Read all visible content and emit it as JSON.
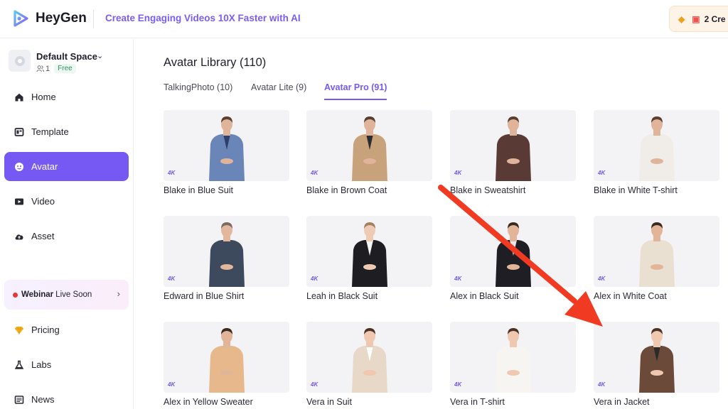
{
  "header": {
    "brand": "HeyGen",
    "tagline": "Create Engaging Videos 10X Faster with AI",
    "credits": "2 Cre"
  },
  "sidebar": {
    "space_name": "Default Space",
    "member_count": "1",
    "plan": "Free",
    "items": [
      {
        "label": "Home",
        "icon": "home-icon"
      },
      {
        "label": "Template",
        "icon": "template-icon"
      },
      {
        "label": "Avatar",
        "icon": "avatar-icon",
        "active": true
      },
      {
        "label": "Video",
        "icon": "video-icon"
      },
      {
        "label": "Asset",
        "icon": "asset-icon"
      }
    ],
    "webinar": {
      "bold": "Webinar",
      "rest": "Live Soon"
    },
    "bottom_items": [
      {
        "label": "Pricing",
        "icon": "diamond-icon"
      },
      {
        "label": "Labs",
        "icon": "flask-icon"
      },
      {
        "label": "News",
        "icon": "news-icon"
      }
    ]
  },
  "library": {
    "title": "Avatar Library (110)",
    "tabs": [
      "TalkingPhoto (10)",
      "Avatar Lite (9)",
      "Avatar Pro (91)"
    ],
    "active_tab": 2,
    "badge": "4K",
    "avatars": [
      {
        "name": "Blake in Blue Suit",
        "top": "#6a86b8",
        "accent": "#2d3f6b",
        "skin": "#e0b49a",
        "hair": "#5a4030"
      },
      {
        "name": "Blake in Brown Coat",
        "top": "#c8a27a",
        "accent": "#2b2b33",
        "skin": "#e0b49a",
        "hair": "#5a4030"
      },
      {
        "name": "Blake in Sweatshirt",
        "top": "#5a3a35",
        "accent": "#5a3a35",
        "skin": "#e0b49a",
        "hair": "#5a4030"
      },
      {
        "name": "Blake in White T-shirt",
        "top": "#f0ede8",
        "accent": "#f0ede8",
        "skin": "#e0b49a",
        "hair": "#5a4030"
      },
      {
        "name": "Edward in Blue Shirt",
        "top": "#3d4a5e",
        "accent": "#3d4a5e",
        "skin": "#e2b79d",
        "hair": "#7a6a60"
      },
      {
        "name": "Leah in Black Suit",
        "top": "#1e1e22",
        "accent": "#f5f5f5",
        "skin": "#efcbb5",
        "hair": "#a2815c"
      },
      {
        "name": "Alex in Black Suit",
        "top": "#1e1e24",
        "accent": "#e8e8ea",
        "skin": "#e3b598",
        "hair": "#3b2a20"
      },
      {
        "name": "Alex in White Coat",
        "top": "#e9e0d2",
        "accent": "#e9e0d2",
        "skin": "#e3b598",
        "hair": "#3b2a20"
      },
      {
        "name": "Alex in Yellow Sweater",
        "top": "#e6b88c",
        "accent": "#e6b88c",
        "skin": "#e3b598",
        "hair": "#3b2a20"
      },
      {
        "name": "Vera in Suit",
        "top": "#e8d8c8",
        "accent": "#ffffff",
        "skin": "#f0c8b0",
        "hair": "#4a3326"
      },
      {
        "name": "Vera in T-shirt",
        "top": "#f7f5f2",
        "accent": "#f7f5f2",
        "skin": "#f0c8b0",
        "hair": "#4a3326"
      },
      {
        "name": "Vera in Jacket",
        "top": "#6b4a3a",
        "accent": "#2a2a2a",
        "skin": "#f0c8b0",
        "hair": "#4a3326"
      }
    ]
  },
  "colors": {
    "accent": "#7559f2",
    "arrow": "#f03a22"
  }
}
